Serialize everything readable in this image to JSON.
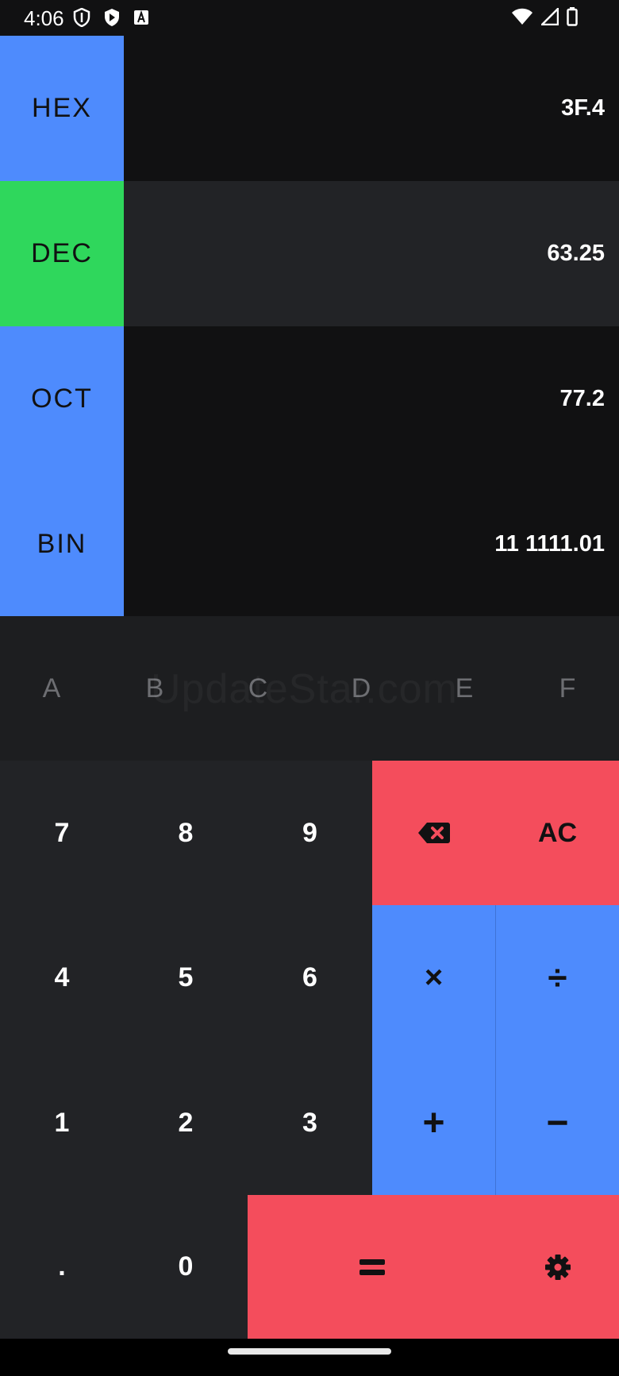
{
  "status_bar": {
    "time": "4:06",
    "left_icons": [
      "shield-icon",
      "play-protect-icon",
      "font-icon"
    ],
    "right_icons": [
      "wifi-icon",
      "signal-icon",
      "battery-icon"
    ]
  },
  "bases": [
    {
      "label": "HEX",
      "value": "3F.4",
      "label_color": "#4e8bfd"
    },
    {
      "label": "DEC",
      "value": "63.25",
      "label_color": "#2fd75c",
      "selected": true
    },
    {
      "label": "OCT",
      "value": "77.2",
      "label_color": "#4e8bfd"
    },
    {
      "label": "BIN",
      "value": "11 1111.01",
      "label_color": "#4e8bfd"
    }
  ],
  "hex_keys": [
    "A",
    "B",
    "C",
    "D",
    "E",
    "F"
  ],
  "watermark": "UpdateStar.com",
  "keypad": {
    "digits": {
      "seven": "7",
      "eight": "8",
      "nine": "9",
      "four": "4",
      "five": "5",
      "six": "6",
      "one": "1",
      "two": "2",
      "three": "3",
      "dot": ".",
      "zero": "0"
    },
    "clear_label": "AC",
    "backspace_icon": "backspace-icon",
    "multiply": "×",
    "divide": "÷",
    "plus": "+",
    "minus": "−",
    "equals_icon": "equals-icon",
    "settings_icon": "gear-icon"
  },
  "colors": {
    "blue": "#4e8bfd",
    "green": "#2fd75c",
    "red": "#f44d5c",
    "background": "#111112",
    "key_background": "#222326"
  }
}
